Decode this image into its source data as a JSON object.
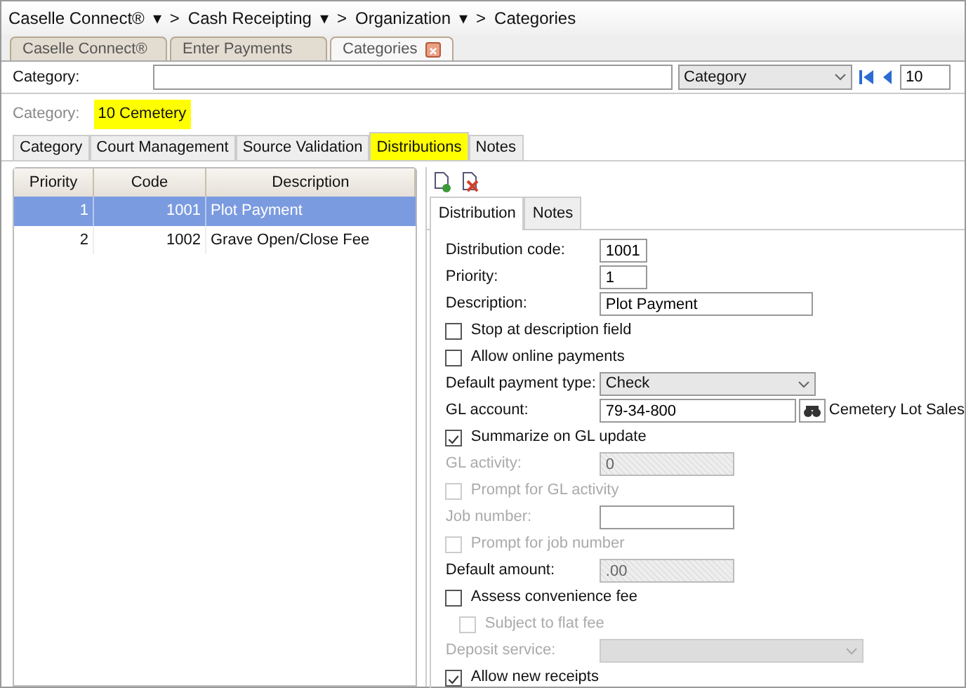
{
  "breadcrumb": [
    {
      "label": "Caselle Connect®",
      "caret": "▾",
      "sep": ">"
    },
    {
      "label": "Cash Receipting",
      "caret": "▾",
      "sep": ">"
    },
    {
      "label": "Organization",
      "caret": "▾",
      "sep": ">"
    },
    {
      "label": "Categories"
    }
  ],
  "doc_tabs": [
    {
      "label": "Caselle Connect®",
      "selected": false,
      "closable": false
    },
    {
      "label": "Enter Payments",
      "selected": false,
      "closable": false
    },
    {
      "label": "Categories",
      "selected": true,
      "closable": true
    }
  ],
  "search_bar": {
    "label": "Category:",
    "select": "Category",
    "record": "10"
  },
  "current": {
    "label": "Category:",
    "value": "10  Cemetery",
    "highlighted": true
  },
  "tabs": [
    {
      "label": "Category",
      "selected": false,
      "highlighted": false
    },
    {
      "label": "Court Management",
      "selected": false,
      "highlighted": false
    },
    {
      "label": "Source Validation",
      "selected": false,
      "highlighted": false
    },
    {
      "label": "Distributions",
      "selected": true,
      "highlighted": true
    },
    {
      "label": "Notes",
      "selected": false,
      "highlighted": false
    }
  ],
  "table": {
    "columns": [
      "Priority",
      "Code",
      "Description"
    ],
    "rows": [
      {
        "cells": [
          "1",
          "1001",
          "Plot Payment"
        ],
        "selected": true
      },
      {
        "cells": [
          "2",
          "1002",
          "Grave Open/Close Fee"
        ],
        "selected": false
      }
    ]
  },
  "detail_tabs": [
    {
      "label": "Distribution",
      "selected": true
    },
    {
      "label": "Notes",
      "selected": false
    }
  ],
  "form": [
    {
      "kind": "short",
      "label": "Distribution code:",
      "value": "1001",
      "disabled": false,
      "readonly": false
    },
    {
      "kind": "short",
      "label": "Priority:",
      "value": "1",
      "disabled": false,
      "readonly": false
    },
    {
      "kind": "long",
      "label": "Description:",
      "value": "Plot Payment",
      "disabled": false,
      "readonly": false
    },
    {
      "kind": "check",
      "label": "Stop at description field",
      "checked": false,
      "disabled": false
    },
    {
      "kind": "check",
      "label": "Allow online payments",
      "checked": false,
      "disabled": false
    },
    {
      "kind": "select",
      "label": "Default payment type:",
      "value": "Check",
      "disabled": false
    },
    {
      "kind": "lookup",
      "label": "GL account:",
      "value": "79-34-800",
      "note": "Cemetery Lot Sales"
    },
    {
      "kind": "check",
      "label": "Summarize on GL update",
      "checked": true,
      "disabled": false
    },
    {
      "kind": "text",
      "label": "GL activity:",
      "value": "0",
      "disabled": true,
      "readonly": true
    },
    {
      "kind": "check",
      "label": "Prompt for GL activity",
      "checked": false,
      "disabled": true
    },
    {
      "kind": "text",
      "label": "Job number:",
      "disabled": true,
      "readonly": false
    },
    {
      "kind": "check",
      "label": "Prompt for job number",
      "checked": false,
      "disabled": true
    },
    {
      "kind": "text",
      "label": "Default amount:",
      "value": ".00",
      "disabled": false,
      "readonly": true
    },
    {
      "kind": "check",
      "label": "Assess convenience fee",
      "checked": false,
      "disabled": false,
      "children": [
        {
          "kind": "check",
          "label": "Subject to flat fee",
          "checked": false,
          "disabled": true
        }
      ]
    },
    {
      "kind": "select",
      "label": "Deposit service:",
      "disabled": true
    },
    {
      "kind": "check",
      "label": "Allow new receipts",
      "checked": true,
      "disabled": false
    }
  ]
}
